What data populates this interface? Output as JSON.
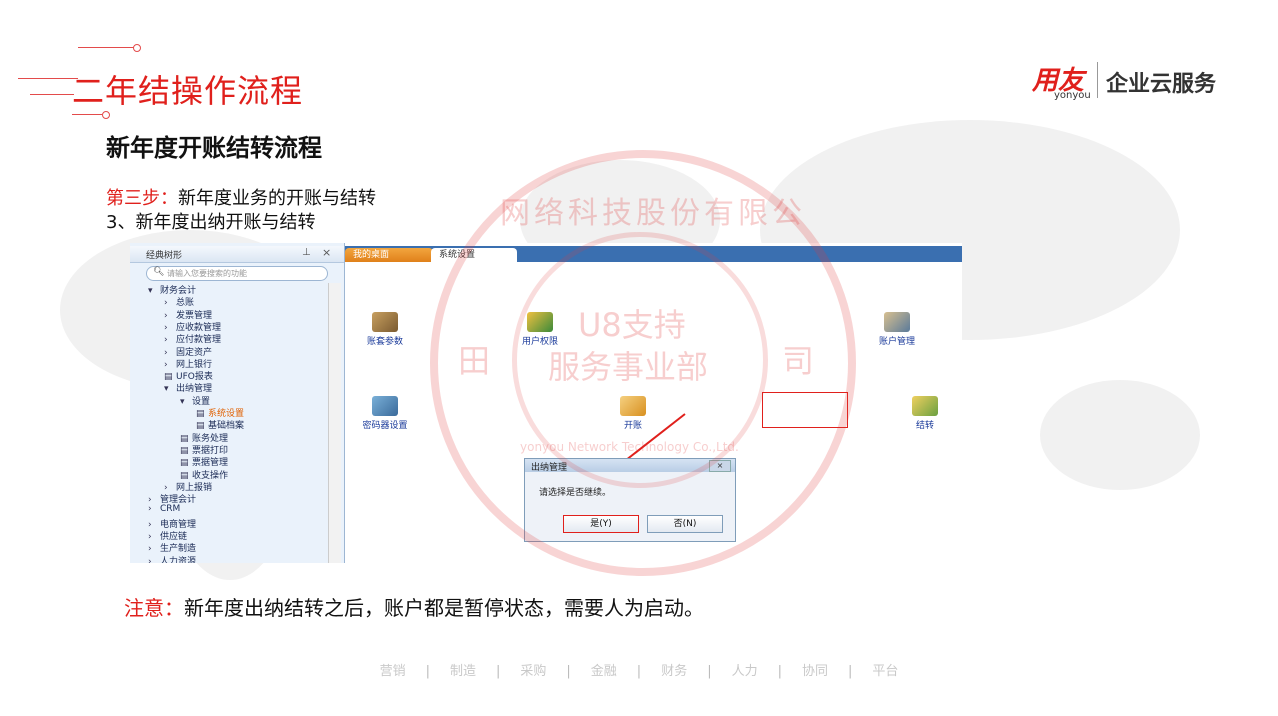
{
  "slide": {
    "title": "二年结操作流程",
    "heading": "新年度开账结转流程",
    "step_label": "第三步：",
    "step_text": "新年度业务的开账与结转",
    "sub_step": "3、新年度出纳开账与结转",
    "note_label": "注意：",
    "note_text": "新年度出纳结转之后，账户都是暂停状态，需要人为启动。"
  },
  "logo": {
    "mark": "用友",
    "sub": "yonyou",
    "text": "企业云服务"
  },
  "app": {
    "tree_title": "经典树形",
    "search_placeholder": "请输入您要搜索的功能",
    "tree_items": [
      {
        "label": "财务会计",
        "arrow": "▾"
      },
      {
        "label": "总账",
        "arrow": "›"
      },
      {
        "label": "发票管理",
        "arrow": "›"
      },
      {
        "label": "应收款管理",
        "arrow": "›"
      },
      {
        "label": "应付款管理",
        "arrow": "›"
      },
      {
        "label": "固定资产",
        "arrow": "›"
      },
      {
        "label": "网上银行",
        "arrow": "›"
      },
      {
        "label": "UFO报表",
        "arrow": "▤"
      },
      {
        "label": "出纳管理",
        "arrow": "▾"
      },
      {
        "label": "设置",
        "arrow": "▾"
      },
      {
        "label": "系统设置",
        "arrow": "▤"
      },
      {
        "label": "基础档案",
        "arrow": "▤"
      },
      {
        "label": "账务处理",
        "arrow": "▤"
      },
      {
        "label": "票据打印",
        "arrow": "▤"
      },
      {
        "label": "票据管理",
        "arrow": "▤"
      },
      {
        "label": "收支操作",
        "arrow": "▤"
      },
      {
        "label": "网上报销",
        "arrow": "›"
      },
      {
        "label": "管理会计",
        "arrow": "›"
      },
      {
        "label": "CRM",
        "arrow": "›"
      },
      {
        "label": "电商管理",
        "arrow": "›"
      },
      {
        "label": "供应链",
        "arrow": "›"
      },
      {
        "label": "生产制造",
        "arrow": "›"
      },
      {
        "label": "人力资源",
        "arrow": "›"
      }
    ],
    "tabs": [
      "我的桌面",
      "系统设置"
    ],
    "functions": {
      "account_params": "账套参数",
      "user_perms": "用户权限",
      "account_mgmt": "账户管理",
      "encryptor": "密码器设置",
      "open_account": "开账",
      "carry_forward": "结转"
    },
    "dialog": {
      "title": "出纳管理",
      "message": "请选择是否继续。",
      "yes": "是(Y)",
      "no": "否(N)"
    }
  },
  "watermark": {
    "arc_text": "网络科技股份有限公",
    "left_char": "田",
    "right_char": "司",
    "line1": "U8支持",
    "line2": "服务事业部",
    "small": "yonyou Network Technology Co.,Ltd."
  },
  "footer": [
    "营销",
    "制造",
    "采购",
    "金融",
    "财务",
    "人力",
    "协同",
    "平台"
  ],
  "colors": {
    "accent": "#e0201c",
    "tab_blue": "#3a6fb0",
    "tab_orange": "#e0801a"
  }
}
